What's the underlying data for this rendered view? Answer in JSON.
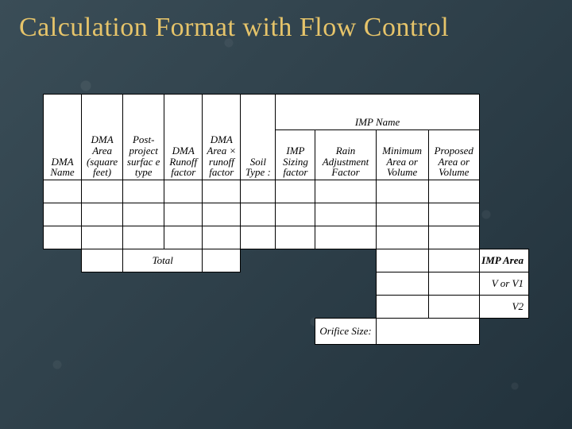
{
  "title": "Calculation Format with Flow Control",
  "headers": {
    "dma_name": "DMA Name",
    "dma_area": "DMA Area (square feet)",
    "surf_type": "Post-project surfac e type",
    "dma_runoff": "DMA Runoff factor",
    "dma_area_runoff": "DMA Area × runoff factor",
    "soil_type": "Soil Type :",
    "imp_name": "IMP Name",
    "imp_sizing": "IMP Sizing factor",
    "rain_adj": "Rain Adjustment Factor",
    "min_area": "Minimum Area or Volume",
    "prop_area": "Proposed Area or Volume"
  },
  "labels": {
    "total": "Total",
    "imp_area": "IMP Area",
    "v_or_v1": "V or V1",
    "v2": "V2",
    "orifice_size": "Orifice Size:"
  }
}
